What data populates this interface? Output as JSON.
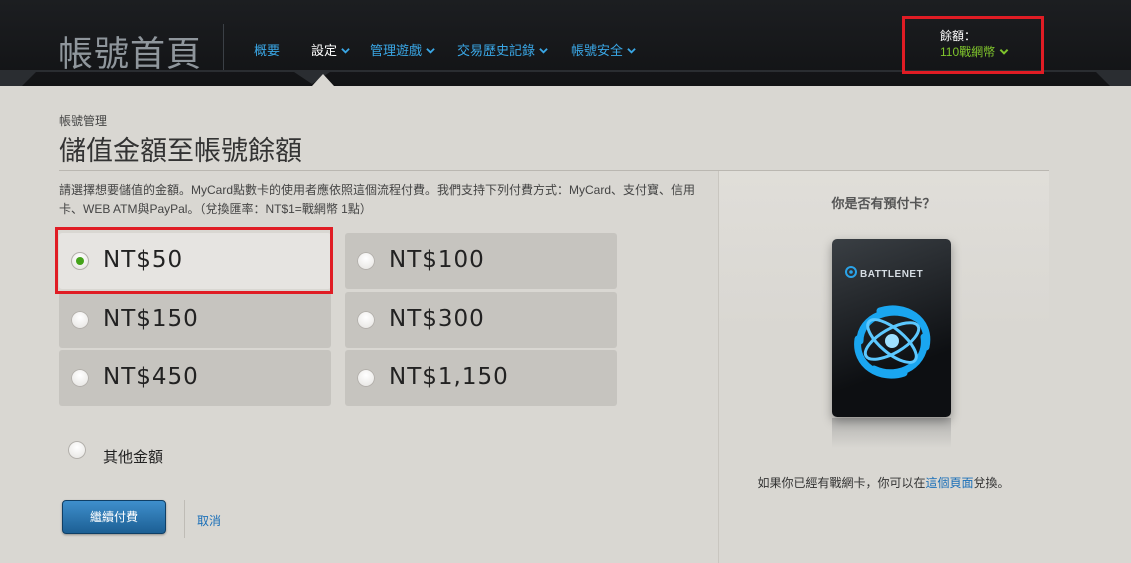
{
  "header": {
    "logo": "帳號首頁",
    "nav": [
      {
        "label": "概要",
        "has_dropdown": false,
        "active": false
      },
      {
        "label": "設定",
        "has_dropdown": true,
        "active": true
      },
      {
        "label": "管理遊戲",
        "has_dropdown": true,
        "active": false
      },
      {
        "label": "交易歷史記錄",
        "has_dropdown": true,
        "active": false
      },
      {
        "label": "帳號安全",
        "has_dropdown": true,
        "active": false
      }
    ],
    "balance_label": "餘額：",
    "balance_value": "110戰網幣"
  },
  "main": {
    "breadcrumb": "帳號管理",
    "title": "儲值金額至帳號餘額",
    "instructions": "請選擇想要儲值的金額。MyCard點數卡的使用者應依照這個流程付費。我們支持下列付費方式：MyCard、支付寶、信用卡、WEB ATM與PayPal。（兌換匯率：NT$1=戰網幣 1點）",
    "amounts": [
      {
        "label": "NT$50",
        "selected": true
      },
      {
        "label": "NT$100",
        "selected": false
      },
      {
        "label": "NT$150",
        "selected": false
      },
      {
        "label": "NT$300",
        "selected": false
      },
      {
        "label": "NT$450",
        "selected": false
      },
      {
        "label": "NT$1,150",
        "selected": false
      }
    ],
    "other_label": "其他金額",
    "continue_label": "繼續付費",
    "cancel_label": "取消"
  },
  "side": {
    "title": "你是否有預付卡？",
    "card_brand": "BATTLENET",
    "text_before": "如果你已經有戰網卡，你可以在",
    "link": "這個頁面",
    "text_after": "兌換。"
  },
  "colors": {
    "header_bg": "#16181b",
    "nav_link": "#3aa7e6",
    "balance_green": "#7fc42c",
    "highlight_red": "#e01c24",
    "radio_selected": "#45a31a",
    "button_blue": "#2a74b0"
  }
}
